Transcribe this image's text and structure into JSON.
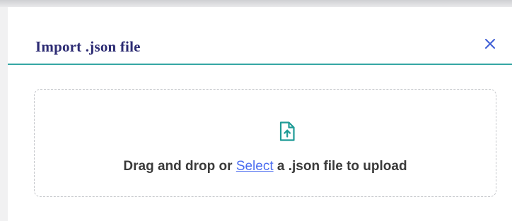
{
  "modal": {
    "title": "Import .json file",
    "close_icon": "close-icon",
    "accent_color": "#35a7a4"
  },
  "dropzone": {
    "icon": "file-upload-icon",
    "text_before": "Drag and drop or ",
    "link_label": "Select",
    "text_after": " a .json file to upload"
  }
}
